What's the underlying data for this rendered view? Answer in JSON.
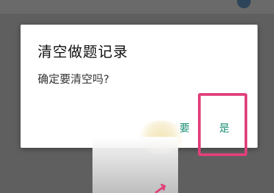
{
  "dialog": {
    "title": "清空做题记录",
    "message": "确定要清空吗?",
    "cancel_label": "要",
    "confirm_label": "是"
  },
  "colors": {
    "accent": "#1e8f76",
    "highlight": "#e0407a",
    "overlay": "#5f5f5f"
  }
}
